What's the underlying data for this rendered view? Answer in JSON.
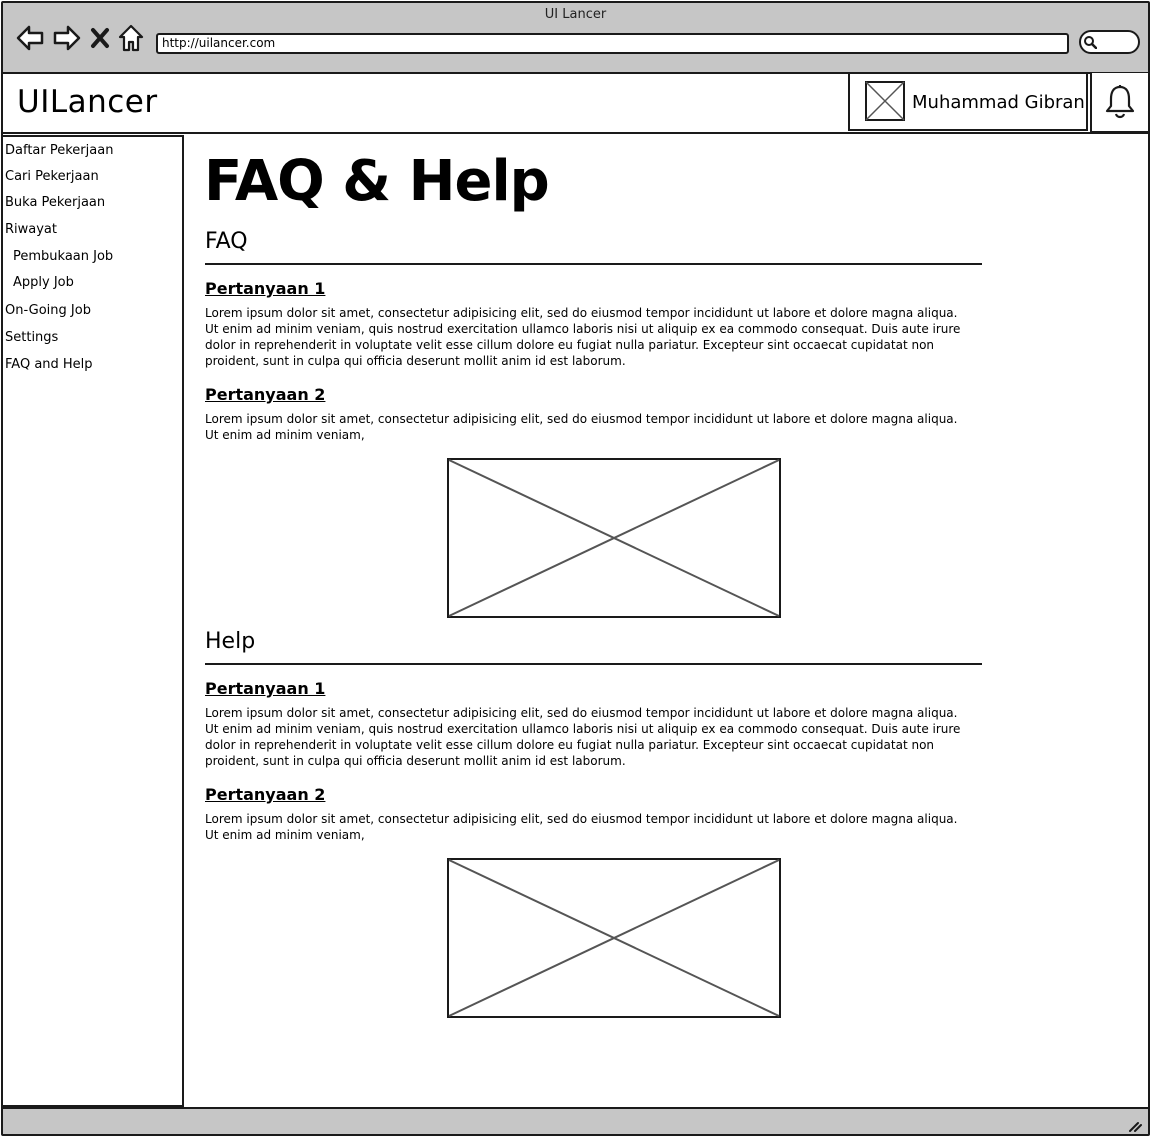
{
  "window": {
    "title": "UI Lancer",
    "url": "http://uilancer.com"
  },
  "header": {
    "brand": "UILancer",
    "user_name": "Muhammad Gibran"
  },
  "sidebar": {
    "items": [
      {
        "label": "Daftar Pekerjaan"
      },
      {
        "label": "Cari Pekerjaan"
      },
      {
        "label": "Buka Pekerjaan"
      },
      {
        "label": "Riwayat"
      },
      {
        "label": "Pembukaan Job"
      },
      {
        "label": "Apply Job"
      },
      {
        "label": "On-Going Job"
      },
      {
        "label": "Settings"
      },
      {
        "label": "FAQ and Help"
      }
    ]
  },
  "main": {
    "page_title": "FAQ & Help",
    "sections": [
      {
        "title": "FAQ",
        "items": [
          {
            "question": "Pertanyaan 1",
            "answer": "Lorem ipsum dolor sit amet, consectetur adipisicing elit, sed do eiusmod tempor incididunt ut labore et dolore magna aliqua. Ut enim ad minim veniam, quis nostrud exercitation ullamco laboris nisi ut aliquip ex ea commodo consequat. Duis aute irure dolor in reprehenderit in voluptate velit esse cillum dolore eu fugiat nulla pariatur. Excepteur sint occaecat cupidatat non proident, sunt in culpa qui officia deserunt mollit anim id est laborum."
          },
          {
            "question": "Pertanyaan 2",
            "answer": "Lorem ipsum dolor sit amet, consectetur adipisicing elit, sed do eiusmod tempor incididunt ut labore et dolore magna aliqua. Ut enim ad minim veniam,"
          }
        ]
      },
      {
        "title": "Help",
        "items": [
          {
            "question": "Pertanyaan 1",
            "answer": "Lorem ipsum dolor sit amet, consectetur adipisicing elit, sed do eiusmod tempor incididunt ut labore et dolore magna aliqua. Ut enim ad minim veniam, quis nostrud exercitation ullamco laboris nisi ut aliquip ex ea commodo consequat. Duis aute irure dolor in reprehenderit in voluptate velit esse cillum dolore eu fugiat nulla pariatur. Excepteur sint occaecat cupidatat non proident, sunt in culpa qui officia deserunt mollit anim id est laborum."
          },
          {
            "question": "Pertanyaan 2",
            "answer": "Lorem ipsum dolor sit amet, consectetur adipisicing elit, sed do eiusmod tempor incididunt ut labore et dolore magna aliqua. Ut enim ad minim veniam,"
          }
        ]
      }
    ]
  },
  "icons": {
    "back": "back-arrow-icon",
    "forward": "forward-arrow-icon",
    "stop": "close-icon",
    "home": "home-icon",
    "search": "search-icon",
    "notification": "bell-icon",
    "avatar": "image-placeholder-icon"
  }
}
